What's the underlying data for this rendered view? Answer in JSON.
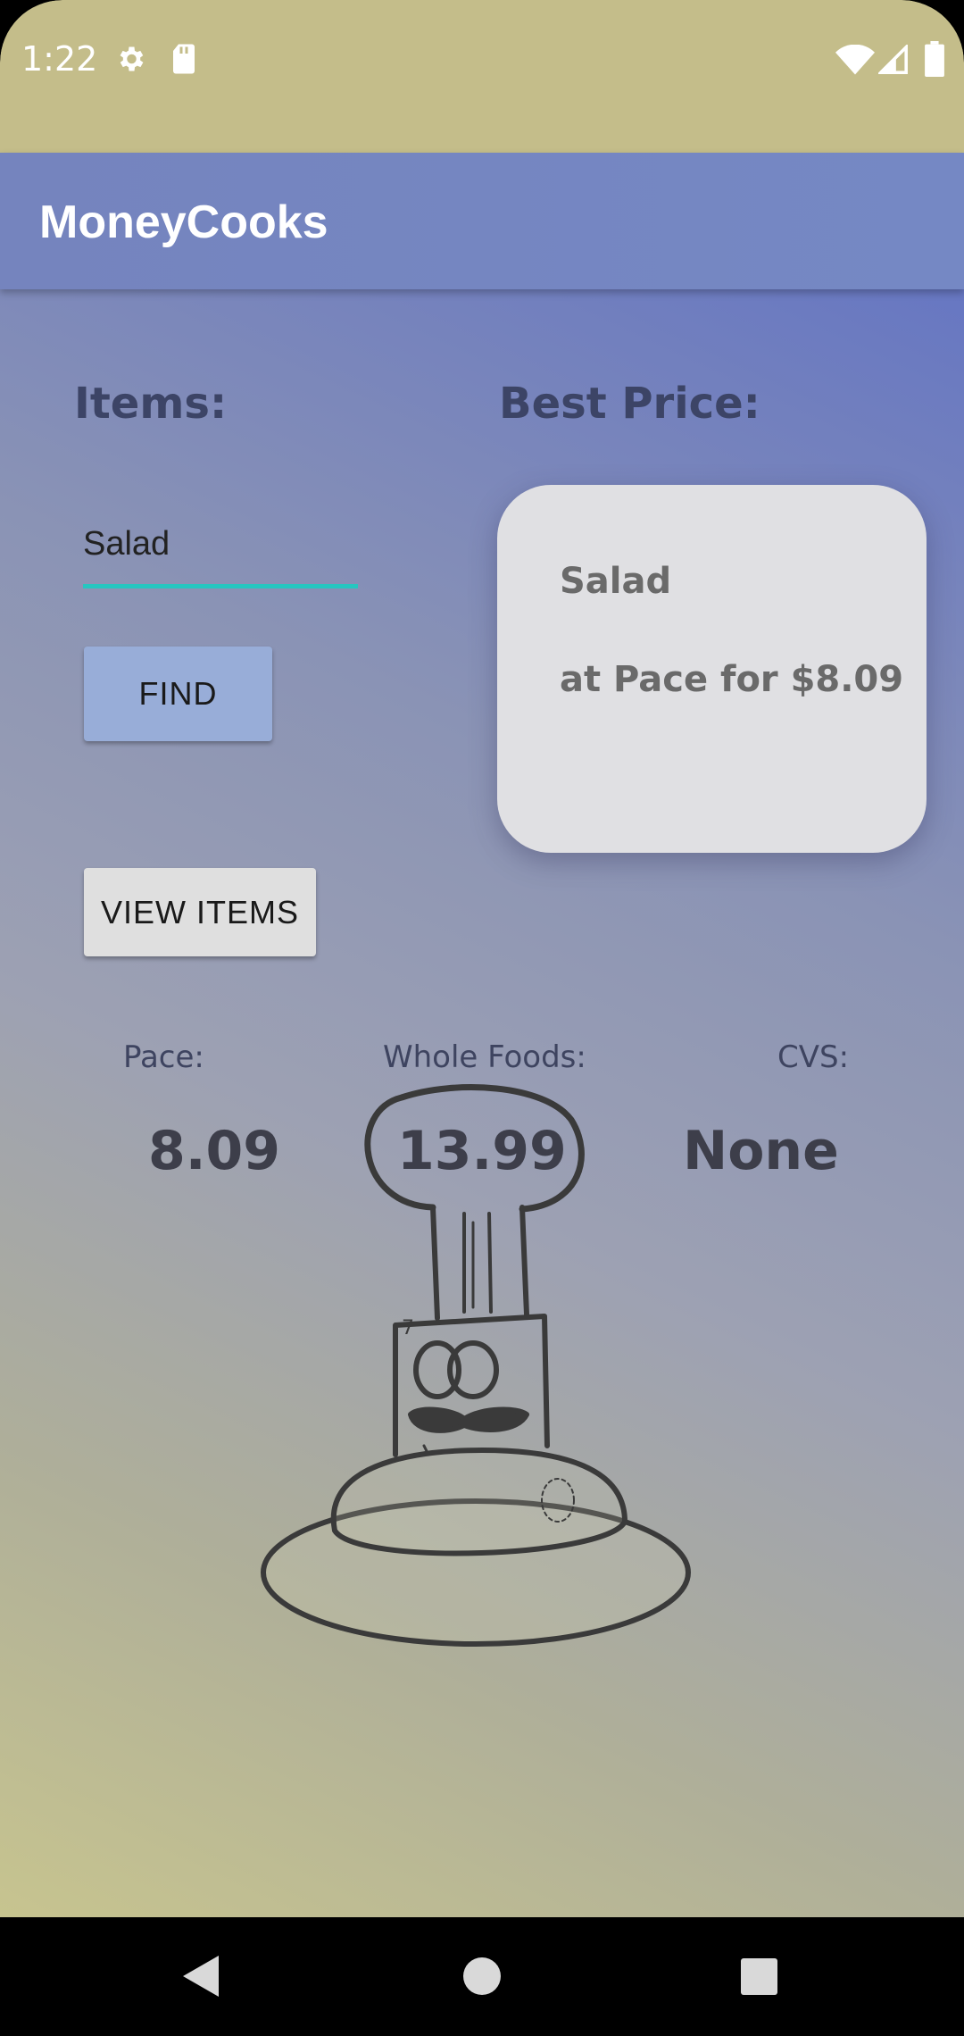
{
  "status_bar": {
    "time": "1:22",
    "icons": [
      "gear-icon",
      "sd-card-icon",
      "wifi-icon",
      "signal-icon",
      "battery-icon"
    ]
  },
  "app_bar": {
    "title": "MoneyCooks"
  },
  "main": {
    "items_heading": "Items:",
    "best_price_heading": "Best Price:",
    "item_input": {
      "value": "Salad",
      "placeholder": ""
    },
    "find_button": "FIND",
    "view_items_button": "VIEW ITEMS",
    "best_price_card": {
      "item": "Salad",
      "detail": "at Pace for $8.09"
    },
    "stores": [
      {
        "label": "Pace:",
        "value": "8.09"
      },
      {
        "label": "Whole Foods:",
        "value": "13.99"
      },
      {
        "label": "CVS:",
        "value": "None"
      }
    ]
  },
  "nav_bar": {
    "buttons": [
      "back-icon",
      "home-icon",
      "recents-icon"
    ]
  },
  "colors": {
    "status_bar": "#c4bd8a",
    "app_bar": "#7584be",
    "input_underline": "#26c6c0",
    "find_button": "#98add8",
    "view_items_button": "#dfdfdf",
    "card": "#e0e0e3"
  }
}
